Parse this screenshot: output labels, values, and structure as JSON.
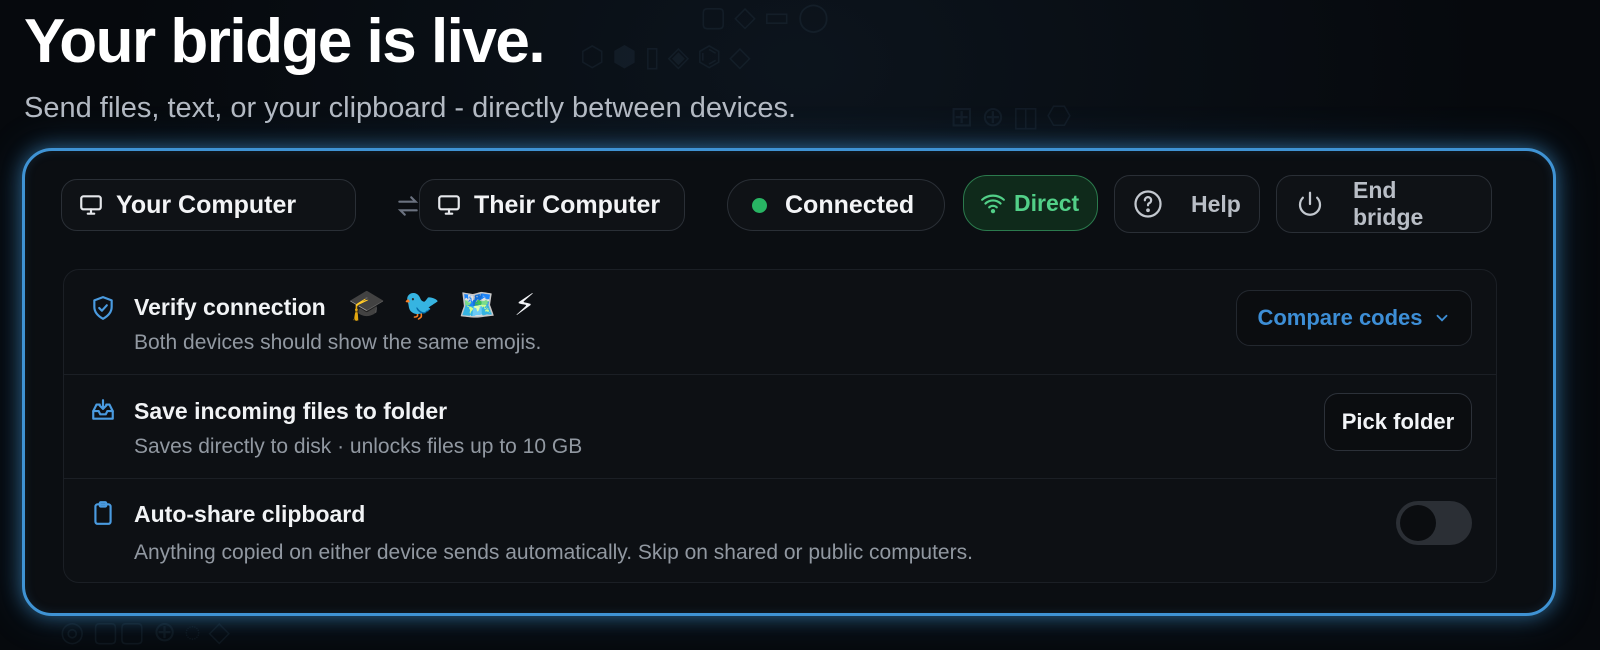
{
  "header": {
    "title": "Your bridge is live.",
    "subtitle": "Send files, text, or your clipboard - directly between devices."
  },
  "toolbar": {
    "local_device": "Your Computer",
    "remote_device": "Their Computer",
    "status": "Connected",
    "connection_type": "Direct",
    "help_label": "Help",
    "end_label": "End bridge"
  },
  "rows": {
    "verify": {
      "title": "Verify connection",
      "subtitle": "Both devices should show the same emojis.",
      "emojis": [
        "🎓",
        "🐦",
        "🗺️",
        "⚡"
      ],
      "action_label": "Compare codes"
    },
    "save": {
      "title": "Save incoming files to folder",
      "subtitle": "Saves directly to disk · unlocks files up to 10 GB",
      "action_label": "Pick folder"
    },
    "clipboard": {
      "title": "Auto-share clipboard",
      "subtitle": "Anything copied on either device sends automatically. Skip on shared or public computers.",
      "enabled": false
    }
  },
  "colors": {
    "accent": "#3f93d4",
    "status_green": "#28b463",
    "direct_green": "#52d088"
  }
}
